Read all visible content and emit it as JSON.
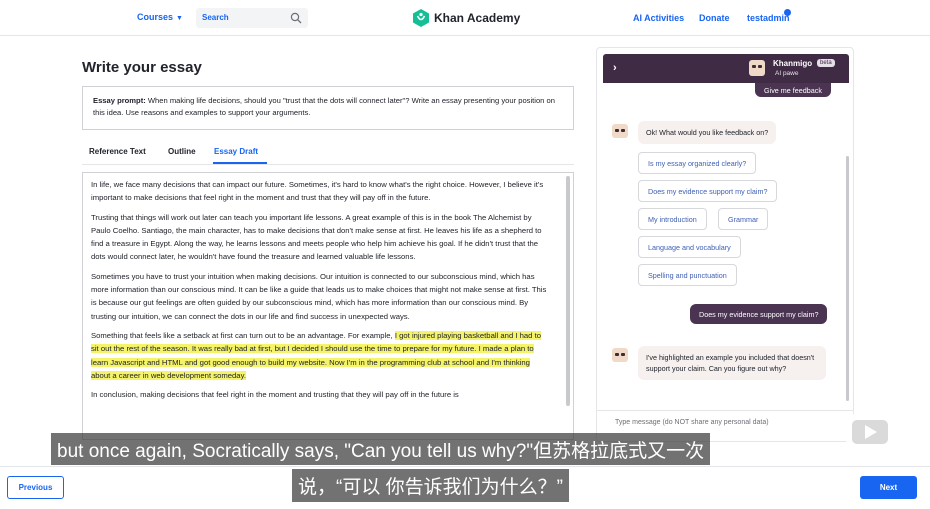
{
  "nav": {
    "courses": "Courses",
    "search_placeholder": "Search",
    "logo_text": "Khan Academy",
    "ai_activities": "AI Activities",
    "donate": "Donate",
    "user": "testadmin"
  },
  "page": {
    "title": "Write your essay",
    "prompt_label": "Essay prompt:",
    "prompt_text": "When making life decisions, should you \"trust that the dots will connect later\"? Write an essay presenting your position on this idea. Use reasons and examples to support your arguments."
  },
  "tabs": [
    {
      "label": "Reference Text"
    },
    {
      "label": "Outline"
    },
    {
      "label": "Essay Draft",
      "active": true
    }
  ],
  "essay": {
    "p1": "In life, we face many decisions that can impact our future. Sometimes, it's hard to know what's the right choice. However, I believe it's important to make decisions that feel right in the moment and trust that they will pay off in the future.",
    "p2": "Trusting that things will work out later can teach you important life lessons. A great example of this is in the book The Alchemist by Paulo Coelho. Santiago, the main character, has to make decisions that don't make sense at first. He leaves his life as a shepherd to find a treasure in Egypt. Along the way, he learns lessons and meets people who help him achieve his goal. If he didn't trust that the dots would connect later, he wouldn't have found the treasure and learned valuable life lessons.",
    "p3": "Sometimes you have to trust your intuition when making decisions. Our intuition is connected to our subconscious mind, which has more information than our conscious mind. It can be like a guide that leads us to make choices that might not make sense at first. This is because our gut feelings are often guided by our subconscious mind, which has more information than our conscious mind. By trusting our intuition, we can connect the dots in our life and find success in unexpected ways.",
    "p4_plain": "Something that feels like a setback at first can turn out to be an advantage. For example, ",
    "p4_highlight": "I got injured playing basketball and I had to sit out the rest of the season. It was really bad at first, but I decided I should use the time to prepare for my future. I made a plan to learn Javascript and HTML and got good enough to build my website. Now I'm in the programming club at school and I'm thinking about a career in web development someday.",
    "p5": "In conclusion, making decisions that feel right in the moment and trusting that they will pay off in the future is"
  },
  "chat": {
    "name": "Khanmigo",
    "beta": "beta",
    "subtitle": "AI pawe",
    "user_msg_1": "Give me feedback",
    "bot_msg_1": "Ok! What would you like feedback on?",
    "chips": [
      "Is my essay organized clearly?",
      "Does my evidence support my claim?",
      "My introduction",
      "Grammar",
      "Language and vocabulary",
      "Spelling and punctuation"
    ],
    "user_msg_2": "Does my evidence support my claim?",
    "bot_msg_2": "I've highlighted an example you included that doesn't support your claim. Can you figure out why?",
    "input_placeholder": "Type message (do NOT share any personal data)"
  },
  "footer": {
    "previous": "Previous",
    "next": "Next"
  },
  "subtitles": {
    "line1": "but once again, Socratically says, \"Can you tell us why?\"但苏格拉底式又一次",
    "line2": "说，“可以 你告诉我们为什么？”"
  },
  "colors": {
    "accent": "#1865f2",
    "chat_header": "#3f2b43",
    "highlight": "#f5f36a"
  }
}
